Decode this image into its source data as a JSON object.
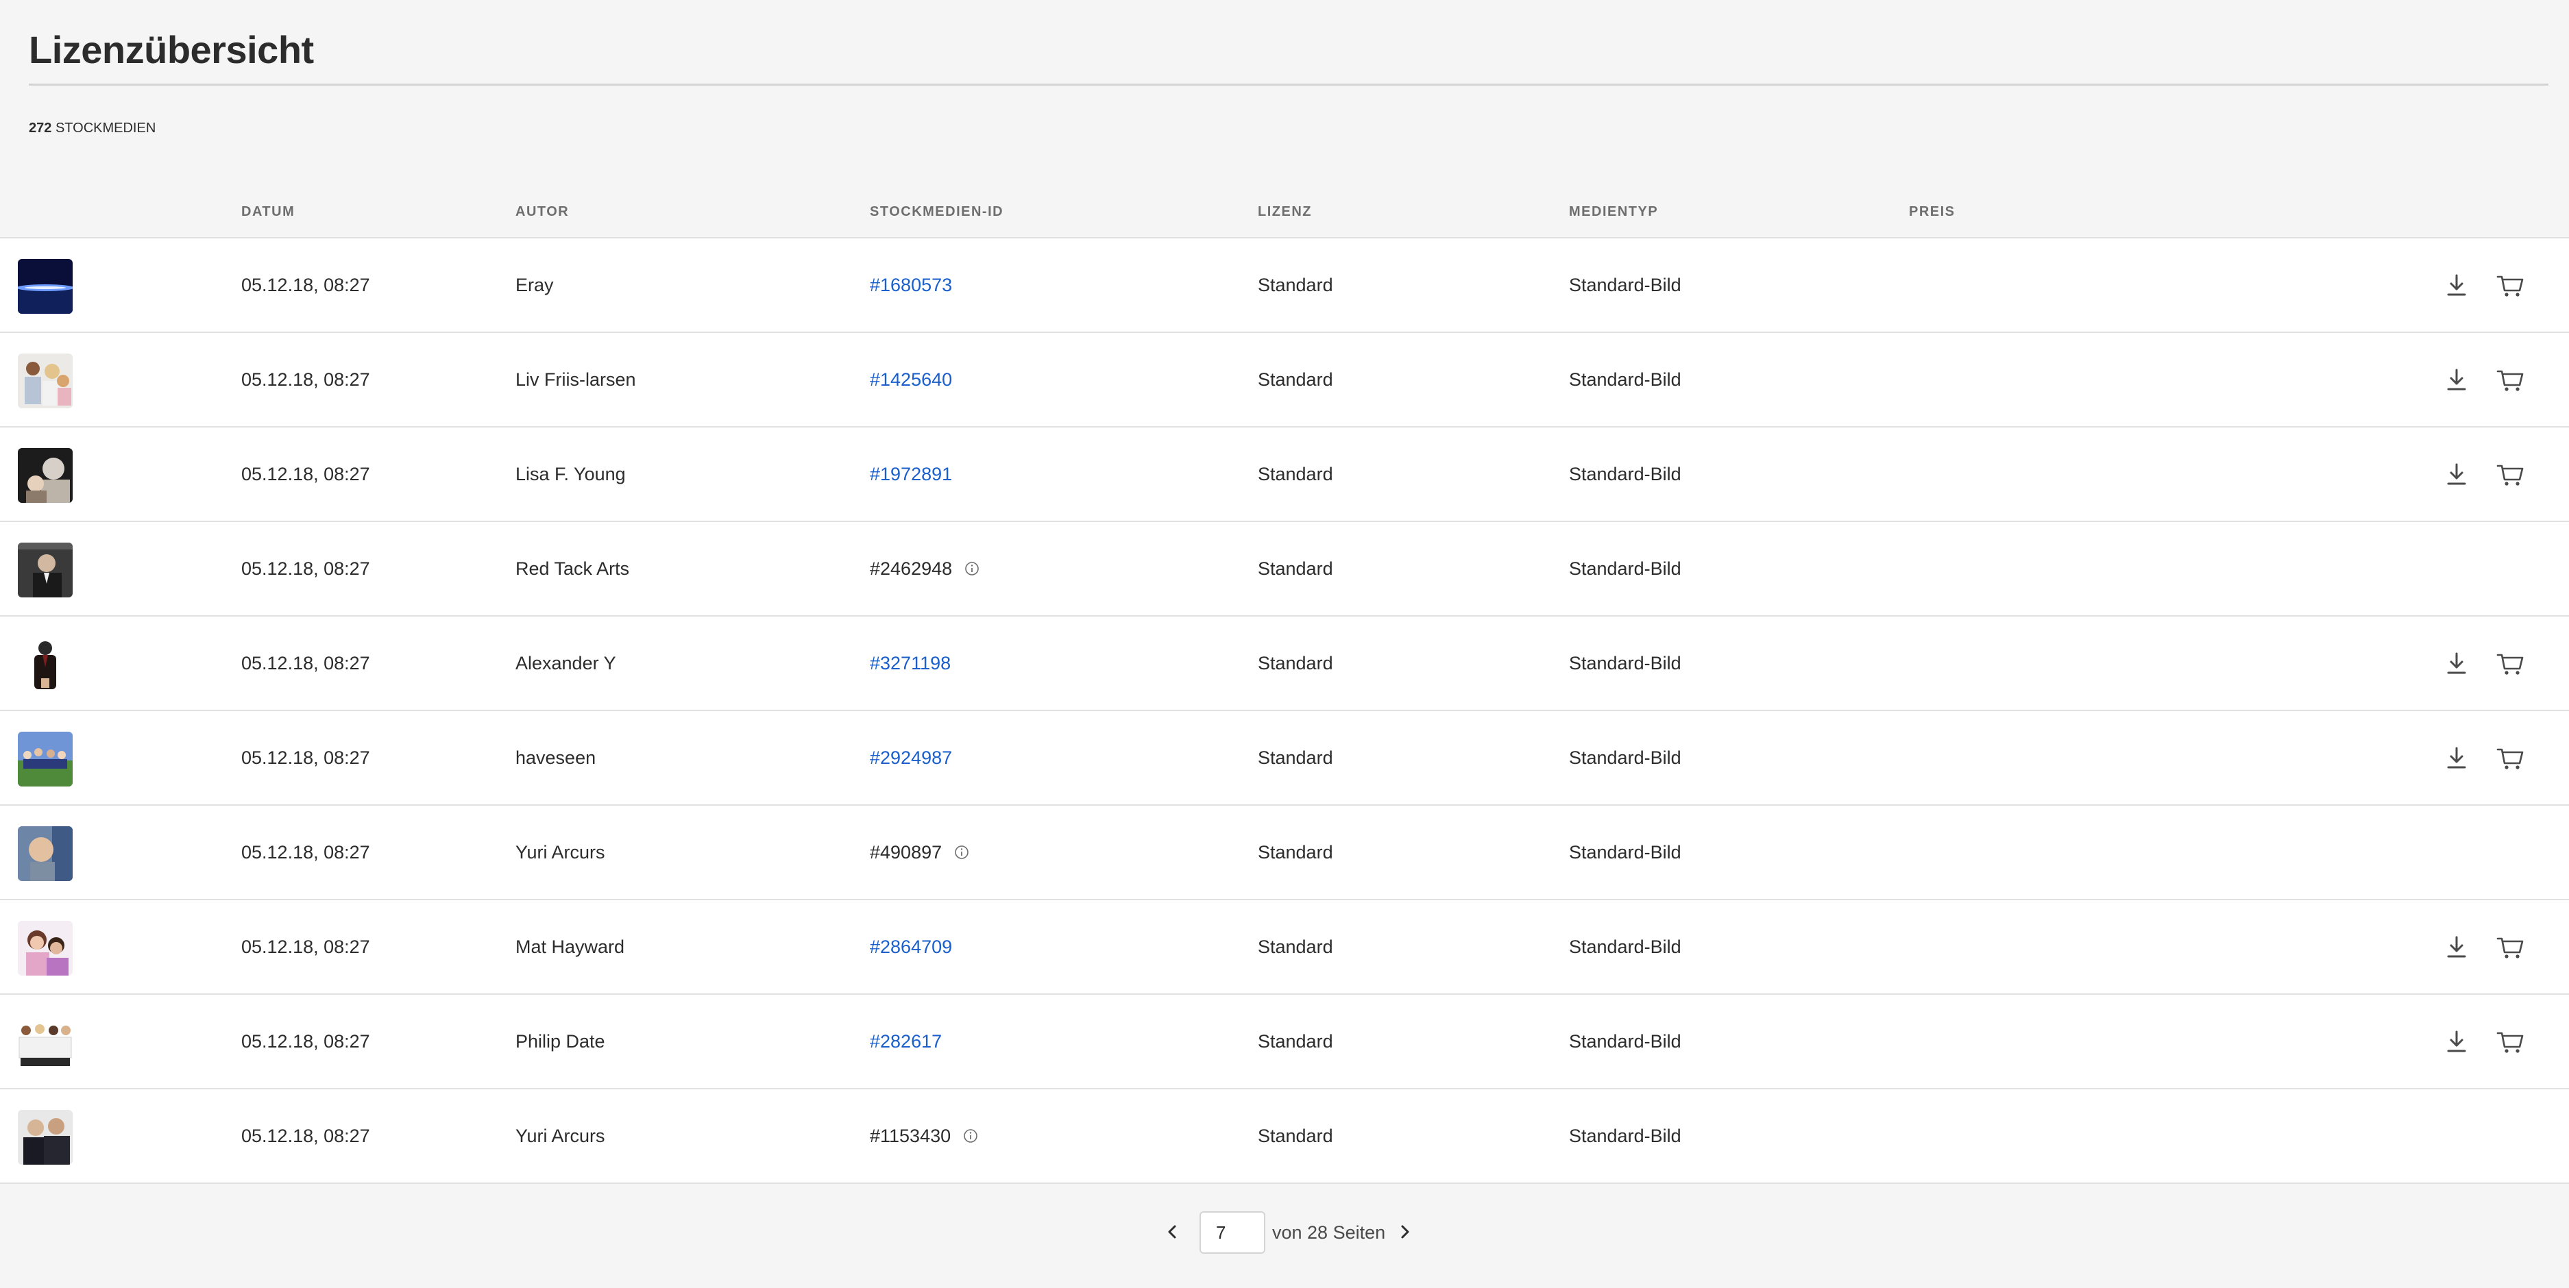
{
  "header": {
    "title": "Lizenzübersicht",
    "summary_count": "272",
    "summary_label": "STOCKMEDIEN"
  },
  "columns": {
    "date": "DATUM",
    "author": "AUTOR",
    "id": "STOCKMEDIEN-ID",
    "license": "LIZENZ",
    "media_type": "MEDIENTYP",
    "price": "PREIS"
  },
  "colors": {
    "accent_link": "#1a5fcc",
    "text": "#2c2c2c",
    "muted": "#6e6e6e",
    "page_bg": "#f5f5f5"
  },
  "rows": [
    {
      "thumb": "thumb-blue-horizon",
      "date": "05.12.18, 08:27",
      "author": "Eray",
      "id": "#1680573",
      "id_linked": true,
      "license": "Standard",
      "media_type": "Standard-Bild",
      "price": "",
      "actions": true
    },
    {
      "thumb": "thumb-family",
      "date": "05.12.18, 08:27",
      "author": "Liv Friis-larsen",
      "id": "#1425640",
      "id_linked": true,
      "license": "Standard",
      "media_type": "Standard-Bild",
      "price": "",
      "actions": true
    },
    {
      "thumb": "thumb-elderly-woman",
      "date": "05.12.18, 08:27",
      "author": "Lisa F. Young",
      "id": "#1972891",
      "id_linked": true,
      "license": "Standard",
      "media_type": "Standard-Bild",
      "price": "",
      "actions": true
    },
    {
      "thumb": "thumb-businessman",
      "date": "05.12.18, 08:27",
      "author": "Red Tack Arts",
      "id": "#2462948",
      "id_linked": false,
      "license": "Standard",
      "media_type": "Standard-Bild",
      "price": "",
      "actions": false
    },
    {
      "thumb": "thumb-man-suit",
      "date": "05.12.18, 08:27",
      "author": "Alexander Y",
      "id": "#3271198",
      "id_linked": true,
      "license": "Standard",
      "media_type": "Standard-Bild",
      "price": "",
      "actions": true
    },
    {
      "thumb": "thumb-group-outdoor",
      "date": "05.12.18, 08:27",
      "author": "haveseen",
      "id": "#2924987",
      "id_linked": true,
      "license": "Standard",
      "media_type": "Standard-Bild",
      "price": "",
      "actions": true
    },
    {
      "thumb": "thumb-man-portrait",
      "date": "05.12.18, 08:27",
      "author": "Yuri Arcurs",
      "id": "#490897",
      "id_linked": false,
      "license": "Standard",
      "media_type": "Standard-Bild",
      "price": "",
      "actions": false
    },
    {
      "thumb": "thumb-couple",
      "date": "05.12.18, 08:27",
      "author": "Mat Hayward",
      "id": "#2864709",
      "id_linked": true,
      "license": "Standard",
      "media_type": "Standard-Bild",
      "price": "",
      "actions": true
    },
    {
      "thumb": "thumb-team-white",
      "date": "05.12.18, 08:27",
      "author": "Philip Date",
      "id": "#282617",
      "id_linked": true,
      "license": "Standard",
      "media_type": "Standard-Bild",
      "price": "",
      "actions": true
    },
    {
      "thumb": "thumb-business-pair",
      "date": "05.12.18, 08:27",
      "author": "Yuri Arcurs",
      "id": "#1153430",
      "id_linked": false,
      "license": "Standard",
      "media_type": "Standard-Bild",
      "price": "",
      "actions": false
    }
  ],
  "pagination": {
    "current_page": "7",
    "label": "von 28 Seiten"
  }
}
